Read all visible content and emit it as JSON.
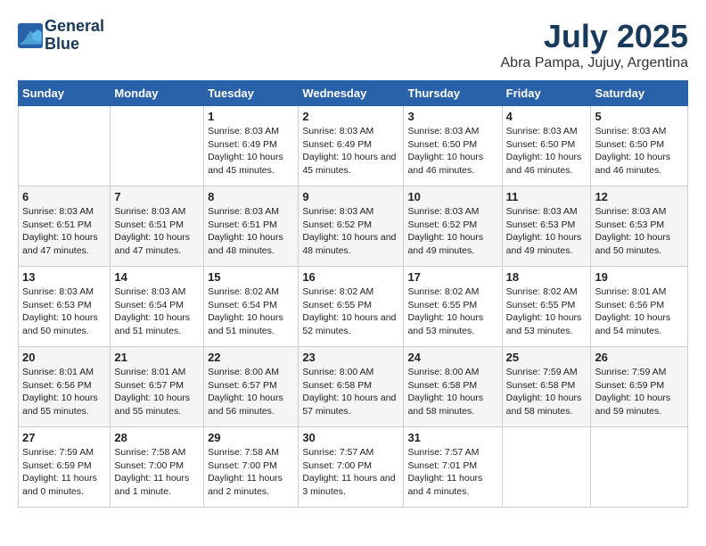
{
  "header": {
    "logo_line1": "General",
    "logo_line2": "Blue",
    "main_title": "July 2025",
    "subtitle": "Abra Pampa, Jujuy, Argentina"
  },
  "weekdays": [
    "Sunday",
    "Monday",
    "Tuesday",
    "Wednesday",
    "Thursday",
    "Friday",
    "Saturday"
  ],
  "weeks": [
    [
      {
        "day": "",
        "info": ""
      },
      {
        "day": "",
        "info": ""
      },
      {
        "day": "1",
        "info": "Sunrise: 8:03 AM\nSunset: 6:49 PM\nDaylight: 10 hours and 45 minutes."
      },
      {
        "day": "2",
        "info": "Sunrise: 8:03 AM\nSunset: 6:49 PM\nDaylight: 10 hours and 45 minutes."
      },
      {
        "day": "3",
        "info": "Sunrise: 8:03 AM\nSunset: 6:50 PM\nDaylight: 10 hours and 46 minutes."
      },
      {
        "day": "4",
        "info": "Sunrise: 8:03 AM\nSunset: 6:50 PM\nDaylight: 10 hours and 46 minutes."
      },
      {
        "day": "5",
        "info": "Sunrise: 8:03 AM\nSunset: 6:50 PM\nDaylight: 10 hours and 46 minutes."
      }
    ],
    [
      {
        "day": "6",
        "info": "Sunrise: 8:03 AM\nSunset: 6:51 PM\nDaylight: 10 hours and 47 minutes."
      },
      {
        "day": "7",
        "info": "Sunrise: 8:03 AM\nSunset: 6:51 PM\nDaylight: 10 hours and 47 minutes."
      },
      {
        "day": "8",
        "info": "Sunrise: 8:03 AM\nSunset: 6:51 PM\nDaylight: 10 hours and 48 minutes."
      },
      {
        "day": "9",
        "info": "Sunrise: 8:03 AM\nSunset: 6:52 PM\nDaylight: 10 hours and 48 minutes."
      },
      {
        "day": "10",
        "info": "Sunrise: 8:03 AM\nSunset: 6:52 PM\nDaylight: 10 hours and 49 minutes."
      },
      {
        "day": "11",
        "info": "Sunrise: 8:03 AM\nSunset: 6:53 PM\nDaylight: 10 hours and 49 minutes."
      },
      {
        "day": "12",
        "info": "Sunrise: 8:03 AM\nSunset: 6:53 PM\nDaylight: 10 hours and 50 minutes."
      }
    ],
    [
      {
        "day": "13",
        "info": "Sunrise: 8:03 AM\nSunset: 6:53 PM\nDaylight: 10 hours and 50 minutes."
      },
      {
        "day": "14",
        "info": "Sunrise: 8:03 AM\nSunset: 6:54 PM\nDaylight: 10 hours and 51 minutes."
      },
      {
        "day": "15",
        "info": "Sunrise: 8:02 AM\nSunset: 6:54 PM\nDaylight: 10 hours and 51 minutes."
      },
      {
        "day": "16",
        "info": "Sunrise: 8:02 AM\nSunset: 6:55 PM\nDaylight: 10 hours and 52 minutes."
      },
      {
        "day": "17",
        "info": "Sunrise: 8:02 AM\nSunset: 6:55 PM\nDaylight: 10 hours and 53 minutes."
      },
      {
        "day": "18",
        "info": "Sunrise: 8:02 AM\nSunset: 6:55 PM\nDaylight: 10 hours and 53 minutes."
      },
      {
        "day": "19",
        "info": "Sunrise: 8:01 AM\nSunset: 6:56 PM\nDaylight: 10 hours and 54 minutes."
      }
    ],
    [
      {
        "day": "20",
        "info": "Sunrise: 8:01 AM\nSunset: 6:56 PM\nDaylight: 10 hours and 55 minutes."
      },
      {
        "day": "21",
        "info": "Sunrise: 8:01 AM\nSunset: 6:57 PM\nDaylight: 10 hours and 55 minutes."
      },
      {
        "day": "22",
        "info": "Sunrise: 8:00 AM\nSunset: 6:57 PM\nDaylight: 10 hours and 56 minutes."
      },
      {
        "day": "23",
        "info": "Sunrise: 8:00 AM\nSunset: 6:58 PM\nDaylight: 10 hours and 57 minutes."
      },
      {
        "day": "24",
        "info": "Sunrise: 8:00 AM\nSunset: 6:58 PM\nDaylight: 10 hours and 58 minutes."
      },
      {
        "day": "25",
        "info": "Sunrise: 7:59 AM\nSunset: 6:58 PM\nDaylight: 10 hours and 58 minutes."
      },
      {
        "day": "26",
        "info": "Sunrise: 7:59 AM\nSunset: 6:59 PM\nDaylight: 10 hours and 59 minutes."
      }
    ],
    [
      {
        "day": "27",
        "info": "Sunrise: 7:59 AM\nSunset: 6:59 PM\nDaylight: 11 hours and 0 minutes."
      },
      {
        "day": "28",
        "info": "Sunrise: 7:58 AM\nSunset: 7:00 PM\nDaylight: 11 hours and 1 minute."
      },
      {
        "day": "29",
        "info": "Sunrise: 7:58 AM\nSunset: 7:00 PM\nDaylight: 11 hours and 2 minutes."
      },
      {
        "day": "30",
        "info": "Sunrise: 7:57 AM\nSunset: 7:00 PM\nDaylight: 11 hours and 3 minutes."
      },
      {
        "day": "31",
        "info": "Sunrise: 7:57 AM\nSunset: 7:01 PM\nDaylight: 11 hours and 4 minutes."
      },
      {
        "day": "",
        "info": ""
      },
      {
        "day": "",
        "info": ""
      }
    ]
  ]
}
